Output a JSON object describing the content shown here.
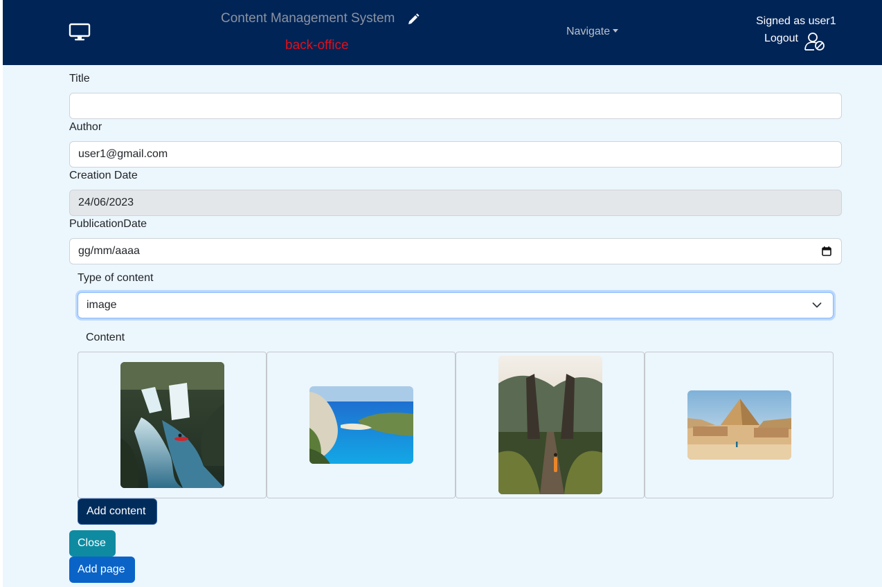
{
  "header": {
    "brand": "Content Management System",
    "subtitle": "back-office",
    "navigate_label": "Navigate",
    "signed_label": "Signed as user1",
    "logout_label": "Logout",
    "icons": [
      "monitor-icon",
      "pencil-icon",
      "caret-down-icon",
      "user-slash-icon"
    ],
    "colors": {
      "navbar": "#012456",
      "subtitle": "#e0101a"
    }
  },
  "form": {
    "title": {
      "label": "Title",
      "value": ""
    },
    "author": {
      "label": "Author",
      "value": "user1@gmail.com"
    },
    "creation_date": {
      "label": "Creation Date",
      "value": "24/06/2023"
    },
    "publication_date": {
      "label": "PublicationDate",
      "value": "gg/mm/aaaa"
    },
    "type_of_content": {
      "label": "Type of content",
      "selected": "image"
    },
    "content_label": "Content"
  },
  "content_items": [
    {
      "icon": "waterfall-kayak-image"
    },
    {
      "icon": "beach-cove-image"
    },
    {
      "icon": "temple-gate-image"
    },
    {
      "icon": "pyramid-desert-image"
    }
  ],
  "buttons": {
    "add_content": "Add content",
    "close": "Close",
    "add_page": "Add page"
  }
}
